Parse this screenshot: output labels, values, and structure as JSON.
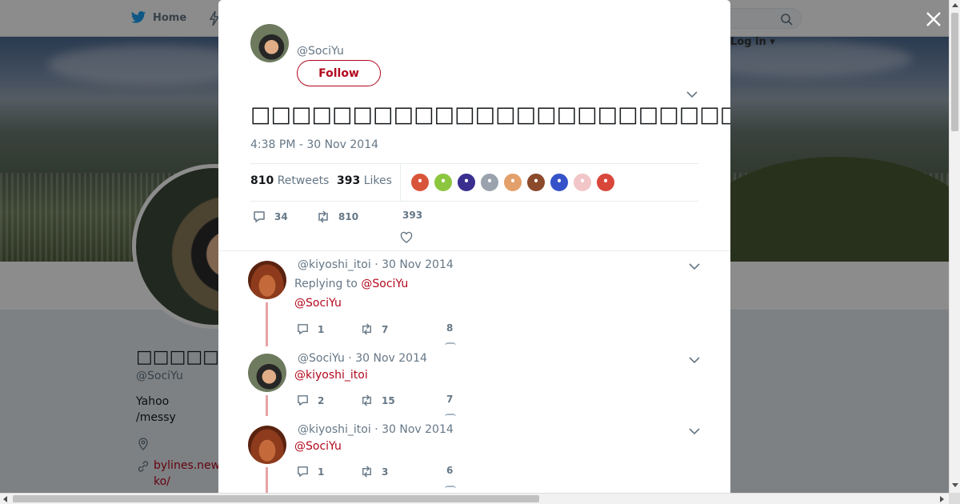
{
  "colors": {
    "brand": "#1da1f2",
    "accent": "#b2071d",
    "muted": "#657786",
    "thread": "#e8a3a6"
  },
  "topbar": {
    "home_label": "Home",
    "login_label": "Log in"
  },
  "profile": {
    "display_name": "□□□□□□",
    "handle": "@SociYu",
    "bio_lines": [
      "Yahoo",
      "/messy"
    ],
    "site_lines": [
      "bylines.new",
      "ko/"
    ]
  },
  "tweet": {
    "handle": "@SociYu",
    "follow_label": "Follow",
    "text": "□□□□□□□□□□□□□□□□□□□□□□□□□□□□□□□□□□□□□□□□□□□□□□□□□□□□□□□□□□□□□□",
    "timestamp": "4:38 PM - 30 Nov 2014",
    "retweets_count": "810",
    "retweets_label": "Retweets",
    "likes_count": "393",
    "likes_label": "Likes",
    "liker_colors": [
      "#d9553a",
      "#8cc63f",
      "#3a2e8f",
      "#9aa3ad",
      "#e3a06b",
      "#8b4a2b",
      "#3552c9",
      "#f2c6c9",
      "#d8473a"
    ],
    "actions": {
      "replies": "34",
      "retweets": "810",
      "likes": "393"
    }
  },
  "replies": [
    {
      "author": "@kiyoshi_itoi",
      "date": "30 Nov 2014",
      "replying_to_label": "Replying to",
      "replying_to": "@SociYu",
      "text": "@SociYu",
      "replies": "1",
      "retweets": "7",
      "likes": "8"
    },
    {
      "author": "@SociYu",
      "date": "30 Nov 2014",
      "text": "@kiyoshi_itoi",
      "replies": "2",
      "retweets": "15",
      "likes": "7"
    },
    {
      "author": "@kiyoshi_itoi",
      "date": "30 Nov 2014",
      "text": "@SociYu",
      "replies": "1",
      "retweets": "3",
      "likes": "6"
    }
  ],
  "icons": {
    "logo": "twitter-bird-icon",
    "search": "search-icon",
    "close": "close-icon",
    "caret": "chevron-down-icon",
    "reply": "reply-icon",
    "retweet": "retweet-icon",
    "like": "heart-icon",
    "location": "location-pin-icon",
    "link": "link-icon"
  }
}
